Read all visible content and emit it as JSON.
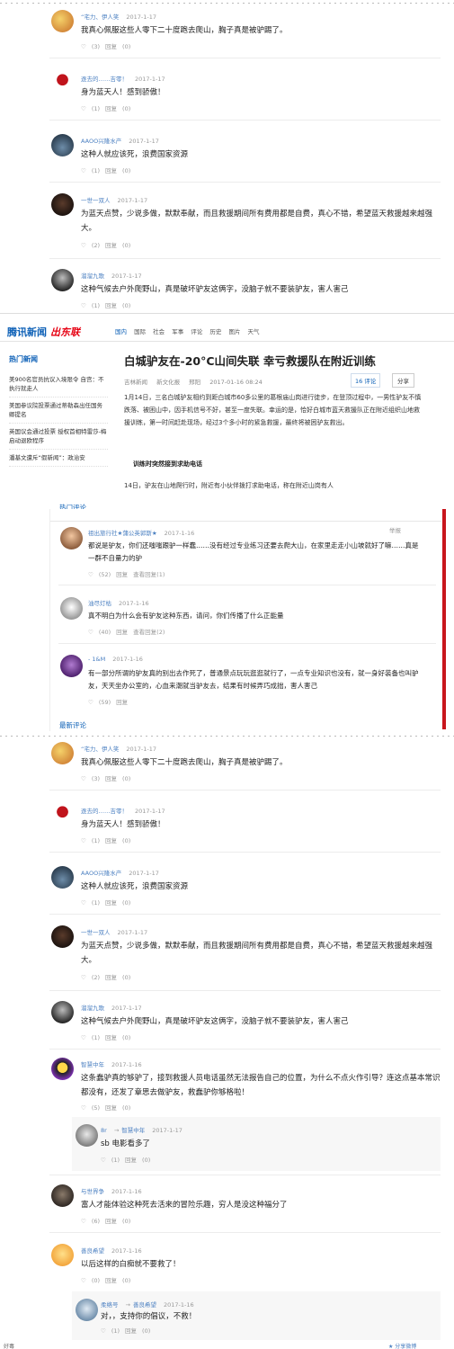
{
  "top_comments": [
    {
      "name": "“宅力、伊人笑",
      "date": "2017-1-17",
      "text": "我真心佩服这些人零下二十度跑去爬山，胸子真是被驴踢了。",
      "likes": "(3)",
      "reply": "回复",
      "reply_count": "(0)"
    },
    {
      "name": "逐去的……吉零！",
      "date": "2017-1-17",
      "text": "身为蓝天人！感到骄傲！",
      "likes": "(1)",
      "reply": "回复",
      "reply_count": "(0)"
    },
    {
      "name": "AAOO兴隆水产",
      "date": "2017-1-17",
      "text": "这种人就应该死，浪费国家资源",
      "likes": "(1)",
      "reply": "回复",
      "reply_count": "(0)"
    },
    {
      "name": "一世一双人",
      "date": "2017-1-17",
      "text": "为蓝天点赞，少说多做，默默奉献，而且救援期间所有费用都是自费，真心不错，希望蓝天救援越来越强大。",
      "likes": "(2)",
      "reply": "回复",
      "reply_count": "(0)"
    },
    {
      "name": "溜溜九歌",
      "date": "2017-1-17",
      "text": "这种气候去户外爬野山，真是破坏驴友这俩字，没脑子就不要装驴友，害人害己",
      "likes": "(1)",
      "reply": "回复",
      "reply_count": "(0)"
    }
  ],
  "news": {
    "logo": "腾讯新闻",
    "logo_tag": "出东联",
    "nav": [
      "国内",
      "国际",
      "社会",
      "军事",
      "评论",
      "历史",
      "图片",
      "天气"
    ],
    "sidebar_title": "热门新闻",
    "sidebar_items": [
      "美900名官员抗议入境限令 自宫：不执行就走人",
      "美国参议院投票通过蒂勒森出任国务卿提名",
      "英国议会通过投票 授权首相特雷莎-梅启动退欧程序",
      "潘基文遭斥“假新闻”：政治安"
    ],
    "headline": "白城驴友在-20°C山间失联 幸亏救援队在附近训练",
    "source": "吉林新闻",
    "category": "新文化报",
    "reporter": "邢阳",
    "datetime": "2017-01-16 08:24",
    "comment_count": "16 评论",
    "share": "分享",
    "paragraph": "1月14日，三名白城驴友相约到距白城市60多公里的葛根庙山岗进行徒步，在登顶过程中，一男性驴友不慎跌落、被困山中，因手机信号不好，甚至一度失联。幸运的是，恰好白城市蓝天救援队正在附近组织山地救援训练，第一时间赶赴现场，经过3个多小时的紧急救援，最终将被困驴友救出。",
    "subhead": "训练时突然接到求助电话",
    "cut_text": "14日，驴友在山地爬行时，附近有小伙伴拨打求助电话，称在附近山岗有人"
  },
  "hot": {
    "title": "热门评论",
    "latest_title": "最新评论",
    "report": "举报",
    "comments": [
      {
        "name": "祖出旅行社★蒲公英郭斯★",
        "date": "2017-1-16",
        "text": "都说是驴友，你们还嗤嗤跟驴一样蠢……没有经过专业练习还要去爬大山，在家里走走小山坡就好了嘛……真是一群不自量力的驴",
        "likes": "(52)",
        "reply": "回复",
        "replies": "查看回复(1)"
      },
      {
        "name": "油尽灯枯",
        "date": "2017-1-16",
        "text": "真不明白为什么会有驴友这种东西，请问，你们传播了什么正能量",
        "likes": "(40)",
        "reply": "回复",
        "replies": "查看回复(2)"
      },
      {
        "name": "- 1&M",
        "date": "2017-1-16",
        "text": "有一部分所谓的驴友真的别出去作死了，普通景点玩玩逛逛就行了，一点专业知识也没有，就一身好装备也叫驴友，天天坐办公室的，心血来潮就当驴友去，结果有时候弄巧成拙，害人害己",
        "likes": "(59)",
        "reply": "回复",
        "replies": ""
      }
    ]
  },
  "bottom_comments": [
    {
      "name": "“宅力、伊人笑",
      "date": "2017-1-17",
      "text": "我真心佩服这些人零下二十度跑去爬山，胸子真是被驴踢了。",
      "likes": "(3)",
      "reply": "回复",
      "reply_count": "(0)"
    },
    {
      "name": "逐去的……吉零！",
      "date": "2017-1-17",
      "text": "身为蓝天人！感到骄傲！",
      "likes": "(1)",
      "reply": "回复",
      "reply_count": "(0)"
    },
    {
      "name": "AAOO兴隆水产",
      "date": "2017-1-17",
      "text": "这种人就应该死，浪费国家资源",
      "likes": "(1)",
      "reply": "回复",
      "reply_count": "(0)"
    },
    {
      "name": "一世一双人",
      "date": "2017-1-17",
      "text": "为蓝天点赞，少说多做，默默奉献，而且救援期间所有费用都是自费，真心不错，希望蓝天救援越来越强大。",
      "likes": "(2)",
      "reply": "回复",
      "reply_count": "(0)"
    },
    {
      "name": "溜溜九歌",
      "date": "2017-1-17",
      "text": "这种气候去户外爬野山，真是破坏驴友这俩字，没脑子就不要装驴友，害人害己",
      "likes": "(1)",
      "reply": "回复",
      "reply_count": "(0)"
    },
    {
      "name": "智慧中年",
      "date": "2017-1-16",
      "text": "这条蠢驴真的够驴了，接到救援人员电话虽然无法报告自己的位置，为什么不点火作引导？连这点基本常识都没有，还发了章思去做驴友，救蠢驴你够格啦！",
      "likes": "(5)",
      "reply": "回复",
      "reply_count": "(0)"
    },
    {
      "name": "与世界争",
      "date": "2017-1-16",
      "text": "富人才能体验这种死去活来的冒险乐趣，穷人是没这种福分了",
      "likes": "(6)",
      "reply": "回复",
      "reply_count": "(0)"
    },
    {
      "name": "善良希望",
      "date": "2017-1-16",
      "text": "以后这样的白痴就不要救了！",
      "likes": "(0)",
      "reply": "回复",
      "reply_count": "(0)"
    }
  ],
  "replies": [
    {
      "name": "8r",
      "to": "智慧中年",
      "date": "2017-1-17",
      "text": "sb 电影看多了",
      "likes": "(1)",
      "reply": "回复",
      "reply_count": "(0)"
    },
    {
      "name": "柔络号",
      "to": "善良希望",
      "date": "2017-1-16",
      "text": "对，，支持你的倡议，不救！",
      "likes": "(1)",
      "reply": "回复",
      "reply_count": "(0)"
    }
  ],
  "bottom_bar": {
    "left": "好毒",
    "right": "★ 分享微博"
  },
  "colors": {
    "link": "#4a7fc1",
    "brand_blue": "#0b5fb6",
    "brand_red": "#e60012"
  }
}
